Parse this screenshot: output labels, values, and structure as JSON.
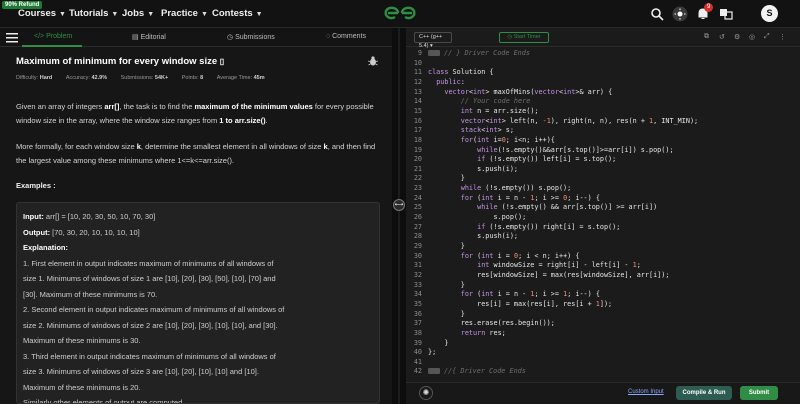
{
  "nav": {
    "refund_badge": "90% Refund",
    "items": [
      {
        "label": "Courses"
      },
      {
        "label": "Tutorials"
      },
      {
        "label": "Jobs"
      },
      {
        "label": "Practice"
      },
      {
        "label": "Contests"
      }
    ],
    "notification_count": "9",
    "avatar_initial": "S",
    "brand_color": "#2f8d46"
  },
  "tabs": [
    {
      "label": "Problem",
      "icon": "code-icon"
    },
    {
      "label": "Editorial",
      "icon": "document-icon"
    },
    {
      "label": "Submissions",
      "icon": "clock-icon"
    },
    {
      "label": "Comments",
      "icon": "comment-icon"
    }
  ],
  "problem": {
    "title": "Maximum of minimum for every window size",
    "difficulty_label": "Difficulty:",
    "difficulty": "Hard",
    "accuracy_label": "Accuracy:",
    "accuracy": "42.9%",
    "submissions_label": "Submissions:",
    "submissions": "54K+",
    "points_label": "Points:",
    "points": "8",
    "avg_time_label": "Average Time:",
    "avg_time": "45m",
    "para1_a": "Given an array of integers ",
    "para1_b": "arr[]",
    "para1_c": ", the task is to find the ",
    "para1_d": "maximum of the minimum values",
    "para1_e": " for every possible window size in the array, where the window size ranges from ",
    "para1_f": "1 to arr.size()",
    "para1_g": ".",
    "para2_a": "More formally, for each window size ",
    "para2_b": "k",
    "para2_c": ", determine the smallest element in all windows of size ",
    "para2_d": "k",
    "para2_e": ", and then find the largest value among these minimums where 1<=k<=arr.size().",
    "examples_heading": "Examples :",
    "input_label": "Input:",
    "input_value": " arr[] = [10, 20, 30, 50, 10, 70, 30]",
    "output_label": "Output:",
    "output_value": " [70, 30, 20, 10, 10, 10, 10]",
    "explanation_label": "Explanation:",
    "explanation_lines": [
      "1. First element in output indicates maximum of minimums of all windows of",
      "size 1. Minimums of windows of size 1 are [10], [20], [30], [50], [10], [70] and",
      "[30]. Maximum of these minimums is 70.",
      "2. Second element in output indicates maximum of minimums of all windows of",
      "size 2. Minimums of windows of size 2 are [10], [20], [30], [10], [10], and [30].",
      "Maximum of these minimums is 30.",
      "3. Third element in output indicates maximum of minimums of all windows of",
      "size 3. Minimums of windows of size 3 are [10], [20], [10], [10] and [10].",
      "Maximum of these minimums is 20.",
      "Similarly other elements of output are computed."
    ]
  },
  "editor": {
    "language": "C++ (g++ 5.4)",
    "timer_label": "Start Timer",
    "code_lines": [
      {
        "n": "9",
        "t": "// } Driver Code Ends"
      },
      {
        "n": "10",
        "t": ""
      },
      {
        "n": "11",
        "t": "class Solution {"
      },
      {
        "n": "12",
        "t": "  public:"
      },
      {
        "n": "13",
        "t": "    vector<int> maxOfMins(vector<int>& arr) {"
      },
      {
        "n": "14",
        "t": "        // Your code here"
      },
      {
        "n": "15",
        "t": "        int n = arr.size();"
      },
      {
        "n": "16",
        "t": "        vector<int> left(n, -1), right(n, n), res(n + 1, INT_MIN);"
      },
      {
        "n": "17",
        "t": "        stack<int> s;"
      },
      {
        "n": "18",
        "t": "        for(int i=0; i<n; i++){"
      },
      {
        "n": "19",
        "t": "            while(!s.empty()&&arr[s.top()]>=arr[i]) s.pop();"
      },
      {
        "n": "20",
        "t": "            if (!s.empty()) left[i] = s.top();"
      },
      {
        "n": "21",
        "t": "            s.push(i);"
      },
      {
        "n": "22",
        "t": "        }"
      },
      {
        "n": "23",
        "t": "        while (!s.empty()) s.pop();"
      },
      {
        "n": "24",
        "t": "        for (int i = n - 1; i >= 0; i--) {"
      },
      {
        "n": "25",
        "t": "            while (!s.empty() && arr[s.top()] >= arr[i])"
      },
      {
        "n": "26",
        "t": "                s.pop();"
      },
      {
        "n": "27",
        "t": "            if (!s.empty()) right[i] = s.top();"
      },
      {
        "n": "28",
        "t": "            s.push(i);"
      },
      {
        "n": "29",
        "t": "        }"
      },
      {
        "n": "30",
        "t": "        for (int i = 0; i < n; i++) {"
      },
      {
        "n": "31",
        "t": "            int windowSize = right[i] - left[i] - 1;"
      },
      {
        "n": "32",
        "t": "            res[windowSize] = max(res[windowSize], arr[i]);"
      },
      {
        "n": "33",
        "t": "        }"
      },
      {
        "n": "34",
        "t": "        for (int i = n - 1; i >= 1; i--) {"
      },
      {
        "n": "35",
        "t": "            res[i] = max(res[i], res[i + 1]);"
      },
      {
        "n": "36",
        "t": "        }"
      },
      {
        "n": "37",
        "t": "        res.erase(res.begin());"
      },
      {
        "n": "38",
        "t": "        return res;"
      },
      {
        "n": "39",
        "t": "    }"
      },
      {
        "n": "40",
        "t": "};"
      },
      {
        "n": "41",
        "t": ""
      },
      {
        "n": "42",
        "t": "//{ Driver Code Ends"
      }
    ],
    "custom_input_label": "Custom Input",
    "compile_label": "Compile & Run",
    "submit_label": "Submit"
  }
}
